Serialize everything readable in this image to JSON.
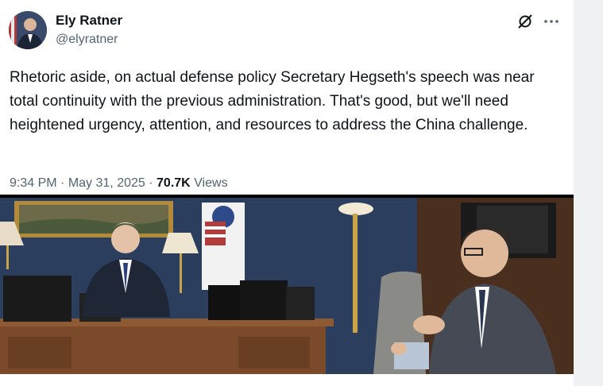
{
  "author": {
    "display_name": "Ely Ratner",
    "handle": "@elyratner"
  },
  "tweet": {
    "text": "Rhetoric aside, on actual defense policy Secretary Hegseth's speech was near total continuity with the previous administration. That's good, but we'll need heightened urgency, attention, and resources to address the China challenge.",
    "time": "9:34 PM",
    "date": "May 31, 2025",
    "views_count": "70.7K",
    "views_label": "Views"
  },
  "icons": {
    "grok": "grok-icon",
    "more": "more-icon"
  },
  "colors": {
    "text": "#0f1419",
    "secondary": "#536471",
    "page_bg": "#f0f1f3"
  }
}
